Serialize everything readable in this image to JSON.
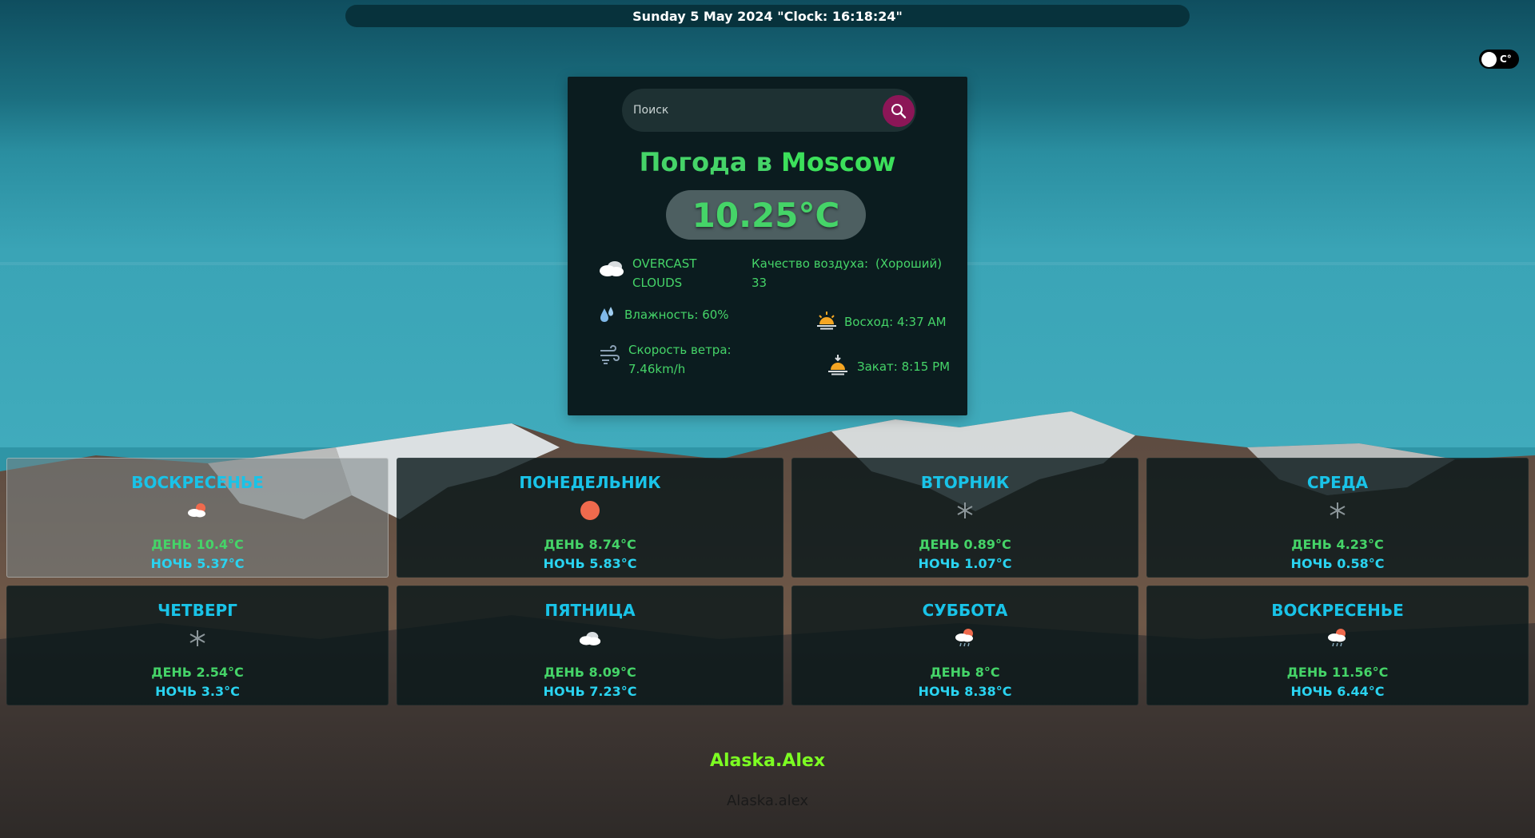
{
  "header": {
    "date_text": "Sunday 5 May 2024 \"Clock: 16:18:24\""
  },
  "unit_toggle": {
    "label": "C°"
  },
  "search": {
    "placeholder": "Поиск",
    "value": ""
  },
  "current": {
    "title_prefix": "Погода в ",
    "city": "Moscow",
    "temperature": "10.25°C",
    "condition": "OVERCAST CLOUDS",
    "air_quality_label": "Качество воздуха:",
    "air_quality_status": "(Хороший)",
    "air_quality_value": "33",
    "humidity": "Влажность: 60%",
    "wind_label": "Скорость ветра:",
    "wind_value": "7.46km/h",
    "sunrise": "Восход: 4:37 AM",
    "sunset": "Закат: 8:15 PM"
  },
  "forecast": [
    {
      "day": "ВОСКРЕСЕНЬЕ",
      "icon": "cloud-sun-icon",
      "day_temp": "ДЕНЬ 10.4°C",
      "night_temp": "НОЧЬ 5.37°C"
    },
    {
      "day": "ПОНЕДЕЛЬНИК",
      "icon": "sun-icon",
      "day_temp": "ДЕНЬ 8.74°C",
      "night_temp": "НОЧЬ 5.83°C"
    },
    {
      "day": "ВТОРНИК",
      "icon": "snowflake-icon",
      "day_temp": "ДЕНЬ 0.89°C",
      "night_temp": "НОЧЬ 1.07°C"
    },
    {
      "day": "СРЕДА",
      "icon": "snowflake-icon",
      "day_temp": "ДЕНЬ 4.23°C",
      "night_temp": "НОЧЬ 0.58°C"
    },
    {
      "day": "ЧЕТВЕРГ",
      "icon": "snowflake-icon",
      "day_temp": "ДЕНЬ 2.54°C",
      "night_temp": "НОЧЬ 3.3°C"
    },
    {
      "day": "ПЯТНИЦА",
      "icon": "cloud-icon",
      "day_temp": "ДЕНЬ 8.09°C",
      "night_temp": "НОЧЬ 7.23°C"
    },
    {
      "day": "СУББОТА",
      "icon": "cloud-sun-rain-icon",
      "day_temp": "ДЕНЬ 8°C",
      "night_temp": "НОЧЬ 8.38°C"
    },
    {
      "day": "ВОСКРЕСЕНЬЕ",
      "icon": "cloud-sun-rain-icon",
      "day_temp": "ДЕНЬ 11.56°C",
      "night_temp": "НОЧЬ 6.44°C"
    }
  ],
  "footer": {
    "name": "Alaska.Alex",
    "sub": "Alaska.alex"
  },
  "colors": {
    "accent_green": "#45d468",
    "day_name_cyan": "#19c3e8",
    "search_button": "#8c1657",
    "footer_green": "#7cff22"
  }
}
